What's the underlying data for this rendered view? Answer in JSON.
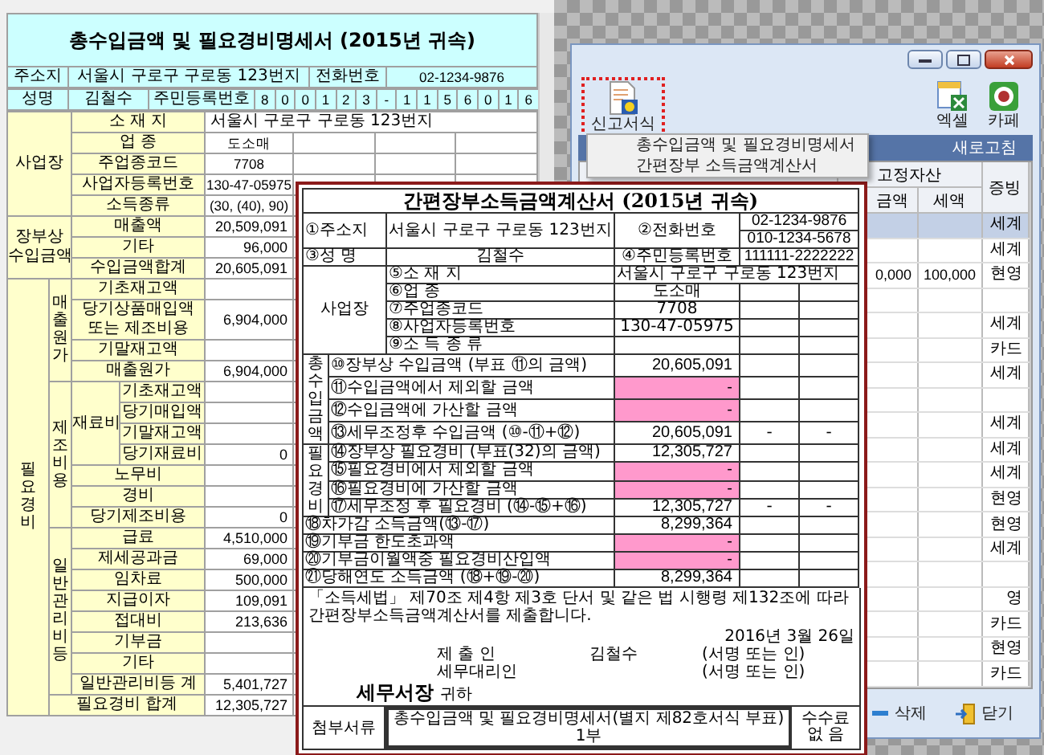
{
  "sheet": {
    "title": "총수입금액 및 필요경비명세서 (2015년 귀속)",
    "address_label": "주소지",
    "address": "서울시 구로구 구로동 123번지",
    "phone_label": "전화번호",
    "phone": "02-1234-9876",
    "name_label": "성명",
    "name": "김철수",
    "id_label": "주민등록번호",
    "id_digits": [
      "8",
      "0",
      "0",
      "1",
      "2",
      "3",
      "-",
      "1",
      "1",
      "5",
      "6",
      "0",
      "1",
      "6"
    ],
    "sections": [
      {
        "label": "사업장",
        "kind": "info",
        "rows": [
          {
            "kind": "wide",
            "label": "소 재 지",
            "value": "서울시 구로구 구로동 123번지"
          },
          {
            "kind": "item",
            "label": "업 종",
            "value": "도소매"
          },
          {
            "kind": "item",
            "label": "주업종코드",
            "value": "7708"
          },
          {
            "kind": "item",
            "label": "사업자등록번호",
            "value": "130-47-05975"
          },
          {
            "kind": "item",
            "label": "소득종류",
            "value": "(30, (40), 90)"
          }
        ]
      },
      {
        "label": "장부상 수입금액",
        "kind": "amounts",
        "rows": [
          {
            "kind": "item",
            "label": "매출액",
            "value": "20,509,091"
          },
          {
            "kind": "item",
            "label": "기타",
            "value": "96,000"
          },
          {
            "kind": "item",
            "label": "수입금액합계",
            "value": "20,605,091"
          }
        ]
      },
      {
        "label": "필요경비",
        "kind": "stacked",
        "rows": [
          {
            "kind": "group",
            "label": "매출원가",
            "rows": [
              {
                "kind": "item",
                "label": "기초재고액"
              },
              {
                "kind": "item",
                "label": "당기상품매입액 또는 제조비용",
                "value": "6,904,000"
              },
              {
                "kind": "item",
                "label": "기말재고액"
              },
              {
                "kind": "item",
                "label": "매출원가",
                "value": "6,904,000"
              }
            ]
          },
          {
            "kind": "group",
            "label": "제조비용",
            "rows": [
              {
                "kind": "group",
                "label": "재료비",
                "rows": [
                  {
                    "kind": "item",
                    "label": "기초재고액"
                  },
                  {
                    "kind": "item",
                    "label": "당기매입액"
                  },
                  {
                    "kind": "item",
                    "label": "기말재고액"
                  },
                  {
                    "kind": "item",
                    "label": "당기재료비",
                    "value": "0"
                  }
                ]
              },
              {
                "kind": "item",
                "label": "노무비"
              },
              {
                "kind": "item",
                "label": "경비"
              },
              {
                "kind": "item",
                "label": "당기제조비용",
                "value": "0"
              }
            ]
          },
          {
            "kind": "group",
            "label": "일반관리비등",
            "rows": [
              {
                "kind": "item",
                "label": "급료",
                "value": "4,510,000"
              },
              {
                "kind": "item",
                "label": "제세공과금",
                "value": "69,000"
              },
              {
                "kind": "item",
                "label": "임차료",
                "value": "500,000"
              },
              {
                "kind": "item",
                "label": "지급이자",
                "value": "109,091"
              },
              {
                "kind": "item",
                "label": "접대비",
                "value": "213,636"
              },
              {
                "kind": "item",
                "label": "기부금"
              },
              {
                "kind": "item",
                "label": "기타"
              },
              {
                "kind": "item",
                "label": "일반관리비등 계",
                "value": "5,401,727"
              }
            ]
          },
          {
            "kind": "item",
            "label": "필요경비 합계",
            "value": "12,305,727"
          }
        ]
      }
    ]
  },
  "window": {
    "toolbar": {
      "report_button": {
        "label": "신고서식",
        "highlighted": true
      },
      "excel_button": "엑셀",
      "cafe_button": "카페"
    },
    "menu": [
      "총수입금액 및 필요경비명세서",
      "간편장부 소득금액계산서"
    ],
    "refresh": "새로고침",
    "columns": {
      "group": "고정자산",
      "amount": "금액",
      "tax": "세액",
      "evidence": "증빙"
    },
    "rows": [
      {
        "evidence": "세계",
        "selected": true
      },
      {
        "evidence": "세계",
        "selected": false
      },
      {
        "amount": "0,000",
        "tax": "100,000",
        "evidence": "현영",
        "selected": false
      },
      {
        "selected": false
      },
      {
        "evidence": "세계",
        "selected": false
      },
      {
        "evidence": "카드",
        "selected": false
      },
      {
        "evidence": "세계",
        "selected": false
      },
      {
        "selected": false
      },
      {
        "evidence": "세계",
        "selected": false
      },
      {
        "evidence": "세계",
        "selected": false
      },
      {
        "evidence": "세계",
        "selected": false
      },
      {
        "evidence": "현영",
        "selected": false
      },
      {
        "evidence": "현영",
        "selected": false
      },
      {
        "evidence": "세계",
        "selected": false
      },
      {
        "selected": false
      },
      {
        "evidence": "영",
        "selected": false
      },
      {
        "evidence": "카드",
        "selected": false
      },
      {
        "evidence": "현영",
        "selected": false
      },
      {
        "evidence": "카드",
        "selected": false
      }
    ],
    "buttons": [
      "삭제",
      "닫기"
    ]
  },
  "statement": {
    "title": "간편장부소득금액계산서 (2015년 귀속)",
    "address_label": "①주소지",
    "address": "서울시 구로구 구로동 123번지",
    "phone_label": "②전화번호",
    "phones": [
      "02-1234-9876",
      "010-1234-5678"
    ],
    "name_label": "③성 명",
    "name": "김철수",
    "id_label": "④주민등록번호",
    "id": "111111-2222222",
    "business": {
      "label": "사업장",
      "rows": [
        {
          "kind": "wide",
          "label": "⑤소 재 지",
          "value": "서울시 구로구 구로동 123번지"
        },
        {
          "kind": "item",
          "label": "⑥업 종",
          "value": "도소매"
        },
        {
          "kind": "item",
          "label": "⑦주업종코드",
          "value": "7708"
        },
        {
          "kind": "item",
          "label": "⑧사업자등록번호",
          "value": "130-47-05975"
        },
        {
          "kind": "item",
          "label": "⑨소 득 종 류"
        }
      ]
    },
    "sections": [
      {
        "label": "총수입금액",
        "rows": [
          {
            "label": "⑩장부상 수입금액 (부표 ⑪의 금액)",
            "value": "20,605,091",
            "highlighted": false
          },
          {
            "label": "⑪수입금액에서 제외할 금액",
            "value": "-",
            "highlighted": true
          },
          {
            "label": "⑫수입금액에 가산할 금액",
            "value": "-",
            "highlighted": true
          },
          {
            "label": "⑬세무조정후 수입금액 (⑩-⑪+⑫)",
            "value": "20,605,091",
            "extra": [
              "-",
              "-"
            ],
            "highlighted": false
          }
        ]
      },
      {
        "label": "필요경비",
        "rows": [
          {
            "label": "⑭장부상 필요경비 (부표(32)의 금액)",
            "value": "12,305,727",
            "highlighted": false
          },
          {
            "label": "⑮필요경비에서 제외할 금액",
            "value": "-",
            "highlighted": true
          },
          {
            "label": "⑯필요경비에 가산할 금액",
            "value": "-",
            "highlighted": true
          },
          {
            "label": "⑰세무조정 후 필요경비 (⑭-⑮+⑯)",
            "value": "12,305,727",
            "extra": [
              "-",
              "-"
            ],
            "highlighted": false
          }
        ]
      }
    ],
    "totals": [
      {
        "label": "⑱차가감 소득금액(⑬-⑰)",
        "value": "8,299,364",
        "highlighted": false
      },
      {
        "label": "⑲기부금 한도초과액",
        "value": "-",
        "highlighted": true
      },
      {
        "label": "⑳기부금이월액중 필요경비산입액",
        "value": "-",
        "highlighted": true
      },
      {
        "label": "㉑당해연도 소득금액 (⑱+⑲-⑳)",
        "value": "8,299,364",
        "highlighted": false
      }
    ],
    "declaration": "「소득세법」 제70조 제4항 제3호 단서 및 같은 법 시행령 제132조에 따라 간편장부소득금액계산서를 제출합니다.",
    "date": "2016년 3월 26일",
    "signers": [
      {
        "role": "제 출 인",
        "name": "김철수",
        "sign": "(서명 또는 인)"
      },
      {
        "role": "세무대리인",
        "sign": "(서명 또는 인)"
      }
    ],
    "recipient": "세무서장",
    "recipient_suffix": "귀하",
    "attachment_label": "첨부서류",
    "attachment": "총수입금액 및 필요경비명세서(별지 제82호서식 부표) 1부",
    "fee_label": "수수료",
    "fee": "없 음"
  }
}
